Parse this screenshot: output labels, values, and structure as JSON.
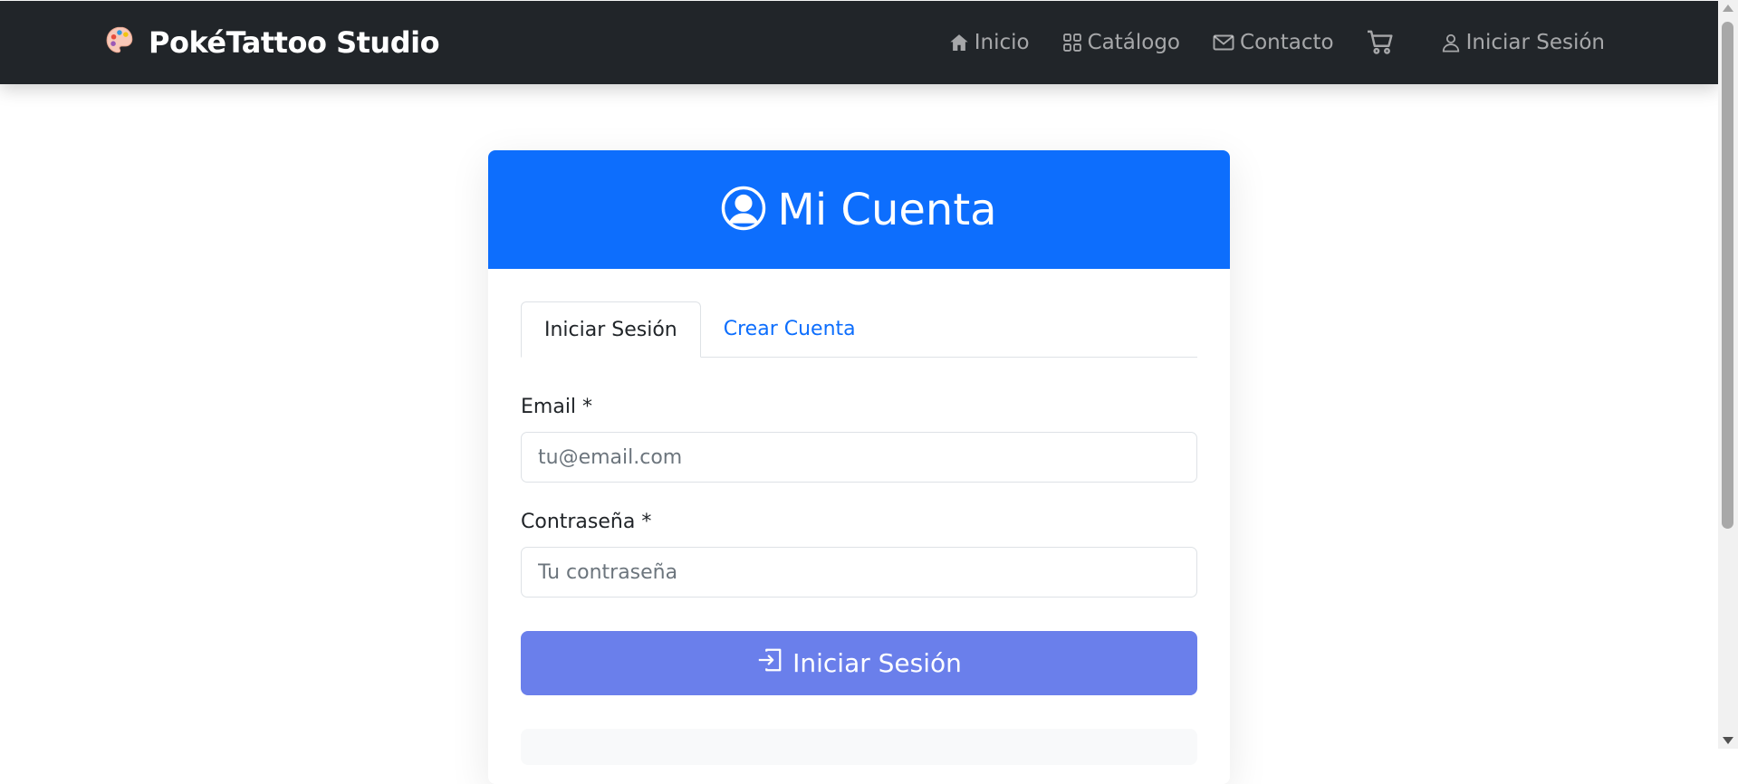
{
  "navbar": {
    "brand_icon": "palette-icon",
    "brand_text": "PokéTattoo Studio",
    "links": {
      "inicio": "Inicio",
      "catalogo": "Catálogo",
      "contacto": "Contacto",
      "login": "Iniciar Sesión"
    },
    "icons": {
      "inicio": "house-icon",
      "catalogo": "grid-icon",
      "contacto": "envelope-icon",
      "cart": "cart-icon",
      "login": "person-icon"
    }
  },
  "card": {
    "title": "Mi Cuenta",
    "title_icon": "person-circle-icon",
    "tabs": [
      {
        "label": "Iniciar Sesión",
        "active": true
      },
      {
        "label": "Crear Cuenta",
        "active": false
      }
    ],
    "form": {
      "email_label": "Email *",
      "email_placeholder": "tu@email.com",
      "email_value": "",
      "password_label": "Contraseña *",
      "password_placeholder": "Tu contraseña",
      "password_value": "",
      "submit_label": "Iniciar Sesión",
      "submit_icon": "box-arrow-in-right-icon"
    }
  },
  "colors": {
    "navbar_bg": "#212529",
    "primary": "#0d6efd",
    "submit_bg": "#6a7feb",
    "nav_text": "rgba(255,255,255,0.6)"
  }
}
